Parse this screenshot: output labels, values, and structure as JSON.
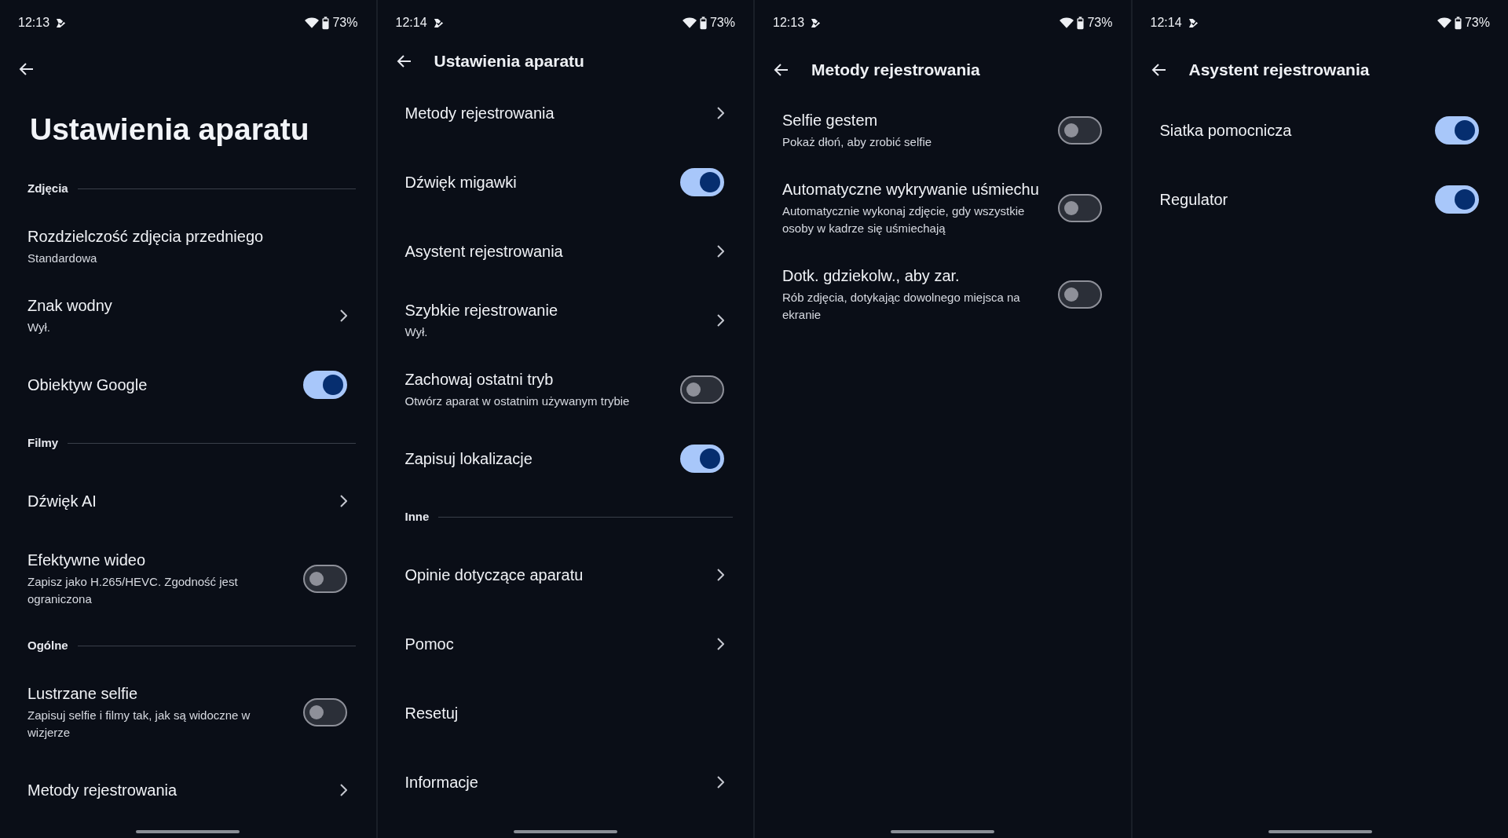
{
  "screens": [
    {
      "status_bar": {
        "time": "12:13",
        "battery": "73%"
      },
      "header": {
        "kind": "large",
        "title": "Ustawienia aparatu"
      },
      "items": [
        {
          "kind": "section",
          "label": "Zdjęcia"
        },
        {
          "kind": "plain",
          "title": "Rozdzielczość zdjęcia przedniego",
          "subtitle": "Standardowa"
        },
        {
          "kind": "link",
          "title": "Znak wodny",
          "subtitle": "Wył."
        },
        {
          "kind": "toggle",
          "title": "Obiektyw Google",
          "on": true
        },
        {
          "kind": "section",
          "label": "Filmy"
        },
        {
          "kind": "link",
          "title": "Dźwięk AI"
        },
        {
          "kind": "toggle",
          "title": "Efektywne wideo",
          "subtitle": "Zapisz jako H.265/HEVC. Zgodność jest ograniczona",
          "on": false
        },
        {
          "kind": "section",
          "label": "Ogólne"
        },
        {
          "kind": "toggle",
          "title": "Lustrzane selfie",
          "subtitle": "Zapisuj selfie i filmy tak, jak są widoczne w wizjerze",
          "on": false
        },
        {
          "kind": "link",
          "title": "Metody rejestrowania"
        }
      ]
    },
    {
      "status_bar": {
        "time": "12:14",
        "battery": "73%"
      },
      "header": {
        "kind": "toolbar",
        "title": "Ustawienia aparatu"
      },
      "items": [
        {
          "kind": "link",
          "title": "Metody rejestrowania"
        },
        {
          "kind": "toggle",
          "title": "Dźwięk migawki",
          "on": true
        },
        {
          "kind": "link",
          "title": "Asystent rejestrowania"
        },
        {
          "kind": "link",
          "title": "Szybkie rejestrowanie",
          "subtitle": "Wył."
        },
        {
          "kind": "toggle",
          "title": "Zachowaj ostatni tryb",
          "subtitle": "Otwórz aparat w ostatnim używanym trybie",
          "on": false
        },
        {
          "kind": "toggle",
          "title": "Zapisuj lokalizacje",
          "on": true
        },
        {
          "kind": "section",
          "label": "Inne"
        },
        {
          "kind": "link",
          "title": "Opinie dotyczące aparatu"
        },
        {
          "kind": "link",
          "title": "Pomoc"
        },
        {
          "kind": "plain",
          "title": "Resetuj"
        },
        {
          "kind": "link",
          "title": "Informacje"
        }
      ]
    },
    {
      "status_bar": {
        "time": "12:13",
        "battery": "73%"
      },
      "header": {
        "kind": "toolbar",
        "title": "Metody rejestrowania"
      },
      "items": [
        {
          "kind": "toggle",
          "title": "Selfie gestem",
          "subtitle": "Pokaż dłoń, aby zrobić selfie",
          "on": false
        },
        {
          "kind": "toggle",
          "title": "Automatyczne wykrywanie uśmiechu",
          "subtitle": "Automatycznie wykonaj zdjęcie, gdy wszystkie osoby w kadrze się uśmiechają",
          "on": false
        },
        {
          "kind": "toggle",
          "title": "Dotk. gdziekolw., aby zar.",
          "subtitle": "Rób zdjęcia, dotykając dowolnego miejsca na ekranie",
          "on": false
        }
      ]
    },
    {
      "status_bar": {
        "time": "12:14",
        "battery": "73%"
      },
      "header": {
        "kind": "toolbar",
        "title": "Asystent rejestrowania"
      },
      "items": [
        {
          "kind": "toggle",
          "title": "Siatka pomocnicza",
          "on": true
        },
        {
          "kind": "toggle",
          "title": "Regulator",
          "on": true
        }
      ]
    }
  ]
}
